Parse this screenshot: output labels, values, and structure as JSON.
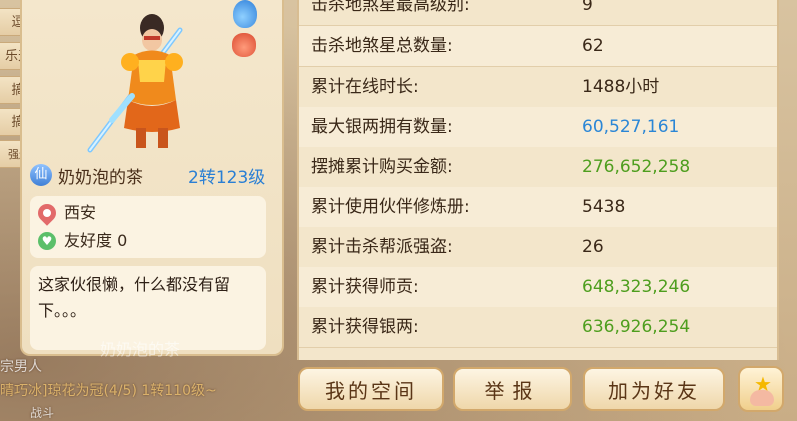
{
  "background": {
    "chat_line_1": "宗男人",
    "chat_line_2": "晴巧冰]琼花为冠(4/5) 1转110级~",
    "chat_line_3": "战斗"
  },
  "side_tags": [
    "逗逼",
    "乐天派",
    "搞笑",
    "搞怪",
    "强迫症"
  ],
  "profile": {
    "sect_badge": "仙",
    "name": "奶奶泡的茶",
    "level": "2转123级",
    "location": "西安",
    "friendship": "友好度 0",
    "signature": "这家伙很懒，什么都没有留下。。。",
    "ghost_name": "奶奶泡的茶"
  },
  "stats": [
    {
      "label": "击杀地煞星最高级别:",
      "value": "9",
      "color": "#3a2818"
    },
    {
      "label": "击杀地煞星总数量:",
      "value": "62",
      "color": "#3a2818"
    },
    {
      "label": "累计在线时长:",
      "value": "1488小时",
      "color": "#3a2818"
    },
    {
      "label": "最大银两拥有数量:",
      "value": "60,527,161",
      "color": "#2a86d6"
    },
    {
      "label": "摆摊累计购买金额:",
      "value": "276,652,258",
      "color": "#4e9e1e"
    },
    {
      "label": "累计使用伙伴修炼册:",
      "value": "5438",
      "color": "#3a2818"
    },
    {
      "label": "累计击杀帮派强盗:",
      "value": "26",
      "color": "#3a2818"
    },
    {
      "label": "累计获得师贡:",
      "value": "648,323,246",
      "color": "#4e9e1e"
    },
    {
      "label": "累计获得银两:",
      "value": "636,926,254",
      "color": "#4e9e1e"
    }
  ],
  "buttons": {
    "space": "我的空间",
    "report": "举报",
    "add_friend": "加为好友"
  },
  "icons": {
    "favorite": "star-hand-icon",
    "bubble": "bubble-icon",
    "bag": "bag-icon"
  }
}
